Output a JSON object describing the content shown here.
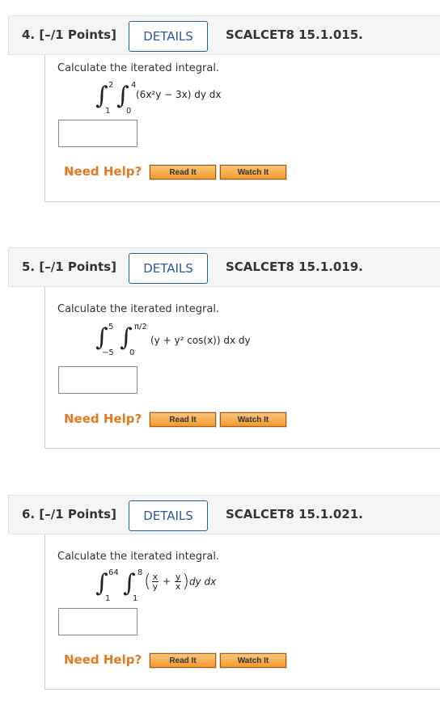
{
  "questions": [
    {
      "title": "4. [–/1 Points]",
      "details_label": "DETAILS",
      "code": "SCALCET8 15.1.015.",
      "prompt": "Calculate the iterated integral.",
      "outer_upper": "2",
      "outer_lower": "1",
      "inner_upper": "4",
      "inner_lower": "0",
      "integrand": "(6x²y − 3x) dy dx",
      "answer": "",
      "need_help": "Need Help?",
      "read_it": "Read It",
      "watch_it": "Watch It"
    },
    {
      "title": "5. [–/1 Points]",
      "details_label": "DETAILS",
      "code": "SCALCET8 15.1.019.",
      "prompt": "Calculate the iterated integral.",
      "outer_upper": "5",
      "outer_lower": "−5",
      "inner_upper": "π/2",
      "inner_lower": "0",
      "integrand": "(y + y² cos(x)) dx dy",
      "answer": "",
      "need_help": "Need Help?",
      "read_it": "Read It",
      "watch_it": "Watch It"
    },
    {
      "title": "6. [–/1 Points]",
      "details_label": "DETAILS",
      "code": "SCALCET8 15.1.021.",
      "prompt": "Calculate the iterated integral.",
      "outer_upper": "64",
      "outer_lower": "1",
      "inner_upper": "8",
      "inner_lower": "1",
      "frac1_num": "x",
      "frac1_den": "y",
      "plus": "+",
      "frac2_num": "y",
      "frac2_den": "x",
      "integrand_tail": "dy dx",
      "answer": "",
      "need_help": "Need Help?",
      "read_it": "Read It",
      "watch_it": "Watch It"
    }
  ]
}
